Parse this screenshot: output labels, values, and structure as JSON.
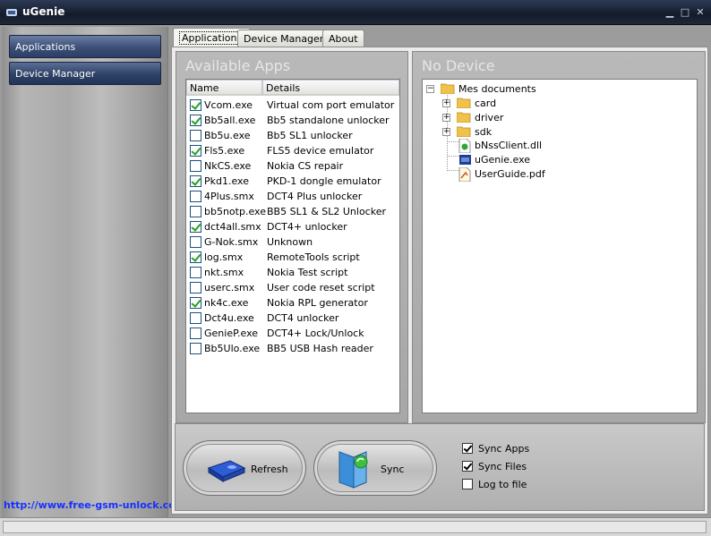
{
  "window": {
    "title": "uGenie",
    "controls": [
      "minimize",
      "maximize",
      "close"
    ]
  },
  "sidebar": {
    "items": [
      {
        "label": "Applications",
        "active": true
      },
      {
        "label": "Device Manager",
        "active": false
      }
    ],
    "link": "http://www.free-gsm-unlock.com"
  },
  "tabs": [
    {
      "label": "Applications",
      "active": true
    },
    {
      "label": "Device Manager",
      "active": false
    },
    {
      "label": "About",
      "active": false
    }
  ],
  "apps_panel": {
    "title": "Available Apps",
    "columns": [
      "Name",
      "Details"
    ],
    "rows": [
      {
        "name": "Vcom.exe",
        "details": "Virtual com port emulator",
        "checked": true
      },
      {
        "name": "Bb5all.exe",
        "details": "Bb5 standalone unlocker",
        "checked": true
      },
      {
        "name": "Bb5u.exe",
        "details": "Bb5 SL1 unlocker",
        "checked": false
      },
      {
        "name": "Fls5.exe",
        "details": "FLS5 device emulator",
        "checked": true
      },
      {
        "name": "NkCS.exe",
        "details": "Nokia CS repair",
        "checked": false
      },
      {
        "name": "Pkd1.exe",
        "details": "PKD-1 dongle emulator",
        "checked": true
      },
      {
        "name": "4Plus.smx",
        "details": "DCT4 Plus unlocker",
        "checked": false
      },
      {
        "name": "bb5notp.exe",
        "details": "BB5 SL1 & SL2 Unlocker",
        "checked": false
      },
      {
        "name": "dct4all.smx",
        "details": "DCT4+ unlocker",
        "checked": true
      },
      {
        "name": "G-Nok.smx",
        "details": "Unknown",
        "checked": false
      },
      {
        "name": "log.smx",
        "details": "RemoteTools script",
        "checked": true
      },
      {
        "name": "nkt.smx",
        "details": "Nokia Test script",
        "checked": false
      },
      {
        "name": "userc.smx",
        "details": "User code reset script",
        "checked": false
      },
      {
        "name": "nk4c.exe",
        "details": "Nokia RPL generator",
        "checked": true
      },
      {
        "name": "Dct4u.exe",
        "details": "DCT4 unlocker",
        "checked": false
      },
      {
        "name": "GenieP.exe",
        "details": "DCT4+ Lock/Unlock",
        "checked": false
      },
      {
        "name": "Bb5Ulo.exe",
        "details": "BB5 USB Hash reader",
        "checked": false
      }
    ]
  },
  "device_panel": {
    "title": "No Device",
    "tree": {
      "root": "Mes documents",
      "folders": [
        "card",
        "driver",
        "sdk"
      ],
      "files": [
        {
          "name": "bNssClient.dll",
          "icon": "dll-file-icon"
        },
        {
          "name": "uGenie.exe",
          "icon": "exe-file-icon"
        },
        {
          "name": "UserGuide.pdf",
          "icon": "pdf-file-icon"
        }
      ]
    }
  },
  "actions": {
    "refresh_label": "Refresh",
    "sync_label": "Sync"
  },
  "options": [
    {
      "label": "Sync Apps",
      "checked": true
    },
    {
      "label": "Sync Files",
      "checked": true
    },
    {
      "label": "Log to file",
      "checked": false
    }
  ]
}
